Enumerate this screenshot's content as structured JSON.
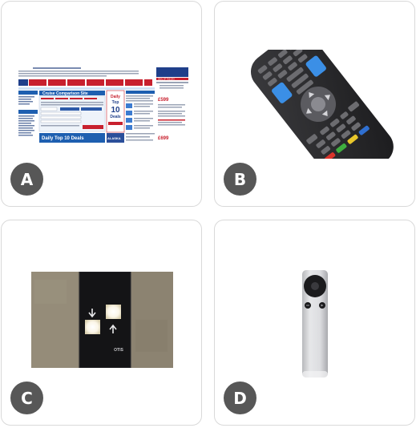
{
  "options": [
    {
      "label": "A",
      "image": "website-screenshot"
    },
    {
      "label": "B",
      "image": "tv-remote-control"
    },
    {
      "label": "C",
      "image": "elevator-call-buttons"
    },
    {
      "label": "D",
      "image": "apple-tv-remote"
    }
  ],
  "website_thumb": {
    "heading": "Cruise Comparison Site",
    "promo": "Daily Top 10 Deals",
    "footer_heading": "Daily Top 10 Deals",
    "side_banner": "DEAL OF THE DAY",
    "price_1": "£599",
    "price_2": "£699",
    "destination": "ALASKA"
  },
  "elevator_brand": "OTIS",
  "colors": {
    "badge": "#575757",
    "card_border": "#d9d9d9"
  }
}
